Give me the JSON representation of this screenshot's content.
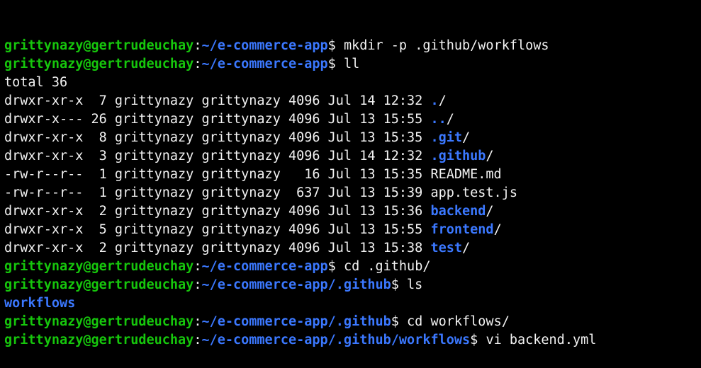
{
  "colors": {
    "background": "#000000",
    "text": "#f2f2f2",
    "prompt_user": "#16c60c",
    "directory": "#3b78ff"
  },
  "lines": [
    {
      "kind": "prompt",
      "user": "grittynazy@gertrudeuchay",
      "path": "~/e-commerce-app",
      "command": "mkdir -p .github/workflows"
    },
    {
      "kind": "prompt",
      "user": "grittynazy@gertrudeuchay",
      "path": "~/e-commerce-app",
      "command": "ll"
    },
    {
      "kind": "text",
      "text": "total 36"
    },
    {
      "kind": "ls",
      "prefix": "drwxr-xr-x  7 grittynazy grittynazy 4096 Jul 14 12:32 ",
      "name": ".",
      "suffix": "/",
      "is_dir": true
    },
    {
      "kind": "ls",
      "prefix": "drwxr-x--- 26 grittynazy grittynazy 4096 Jul 13 15:55 ",
      "name": "..",
      "suffix": "/",
      "is_dir": true
    },
    {
      "kind": "ls",
      "prefix": "drwxr-xr-x  8 grittynazy grittynazy 4096 Jul 13 15:35 ",
      "name": ".git",
      "suffix": "/",
      "is_dir": true
    },
    {
      "kind": "ls",
      "prefix": "drwxr-xr-x  3 grittynazy grittynazy 4096 Jul 14 12:32 ",
      "name": ".github",
      "suffix": "/",
      "is_dir": true
    },
    {
      "kind": "ls",
      "prefix": "-rw-r--r--  1 grittynazy grittynazy   16 Jul 13 15:35 ",
      "name": "README.md",
      "suffix": "",
      "is_dir": false
    },
    {
      "kind": "ls",
      "prefix": "-rw-r--r--  1 grittynazy grittynazy  637 Jul 13 15:39 ",
      "name": "app.test.js",
      "suffix": "",
      "is_dir": false
    },
    {
      "kind": "ls",
      "prefix": "drwxr-xr-x  2 grittynazy grittynazy 4096 Jul 13 15:36 ",
      "name": "backend",
      "suffix": "/",
      "is_dir": true
    },
    {
      "kind": "ls",
      "prefix": "drwxr-xr-x  5 grittynazy grittynazy 4096 Jul 13 15:55 ",
      "name": "frontend",
      "suffix": "/",
      "is_dir": true
    },
    {
      "kind": "ls",
      "prefix": "drwxr-xr-x  2 grittynazy grittynazy 4096 Jul 13 15:38 ",
      "name": "test",
      "suffix": "/",
      "is_dir": true
    },
    {
      "kind": "prompt",
      "user": "grittynazy@gertrudeuchay",
      "path": "~/e-commerce-app",
      "command": "cd .github/"
    },
    {
      "kind": "prompt",
      "user": "grittynazy@gertrudeuchay",
      "path": "~/e-commerce-app/.github",
      "command": "ls"
    },
    {
      "kind": "dirlist",
      "text": "workflows"
    },
    {
      "kind": "prompt",
      "user": "grittynazy@gertrudeuchay",
      "path": "~/e-commerce-app/.github",
      "command": "cd workflows/"
    },
    {
      "kind": "prompt",
      "user": "grittynazy@gertrudeuchay",
      "path": "~/e-commerce-app/.github/workflows",
      "command": "vi backend.yml"
    }
  ]
}
